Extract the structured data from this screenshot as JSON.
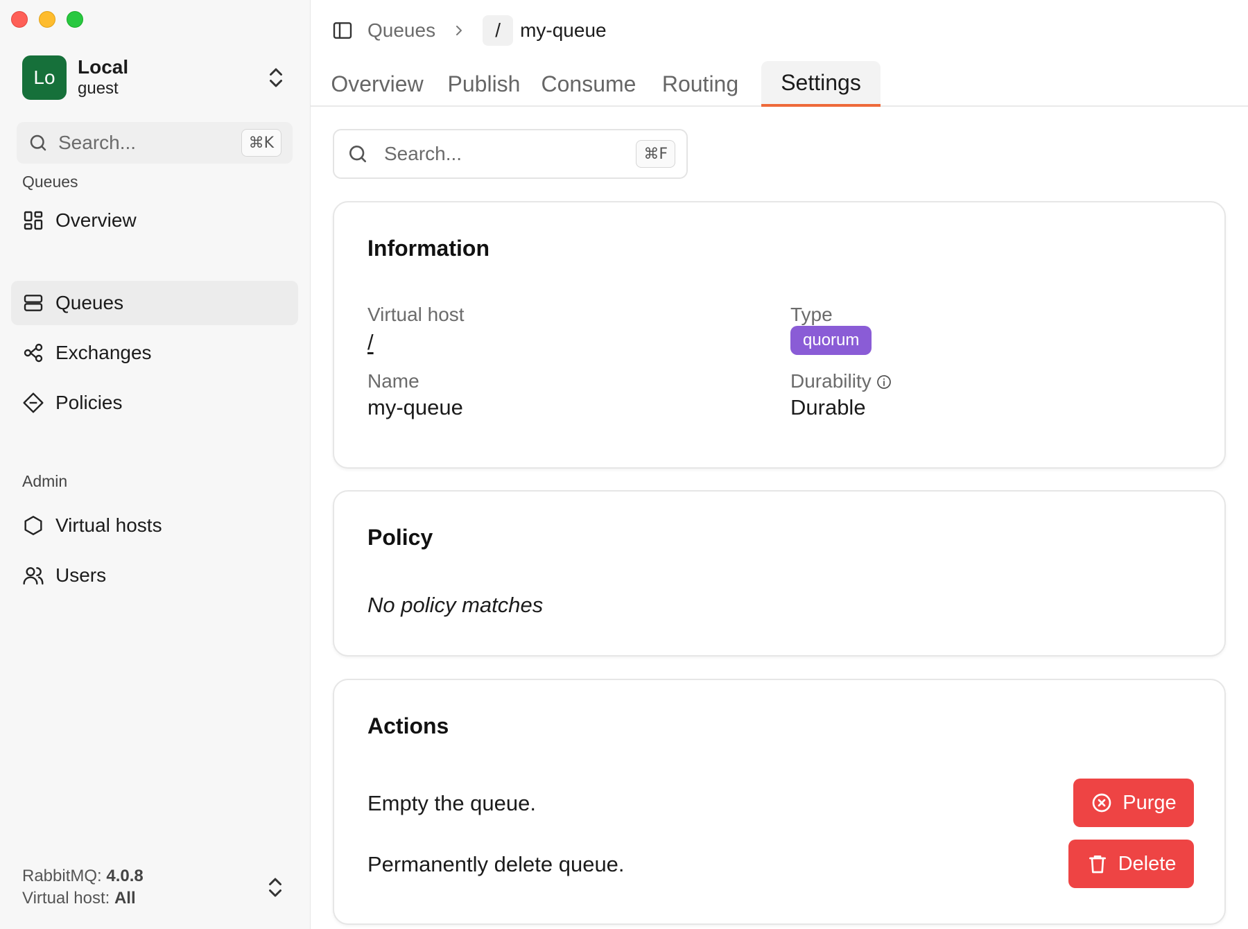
{
  "connection": {
    "initials": "Lo",
    "name": "Local",
    "user": "guest"
  },
  "sidebar": {
    "search_placeholder": "Search...",
    "search_shortcut": "⌘K",
    "queues_section": "Queues",
    "admin_section": "Admin",
    "items": [
      {
        "label": "Overview",
        "icon": "grid-icon"
      },
      {
        "label": "Queues",
        "icon": "queues-icon",
        "active": true
      },
      {
        "label": "Exchanges",
        "icon": "exchange-icon"
      },
      {
        "label": "Policies",
        "icon": "policy-icon"
      },
      {
        "label": "Virtual hosts",
        "icon": "hexagon-icon"
      },
      {
        "label": "Users",
        "icon": "users-icon"
      }
    ],
    "footer": {
      "version_label": "RabbitMQ:",
      "version": "4.0.8",
      "vhost_label": "Virtual host:",
      "vhost": "All"
    }
  },
  "breadcrumb": {
    "section": "Queues",
    "vhost": "/",
    "queue": "my-queue"
  },
  "tabs": [
    "Overview",
    "Publish",
    "Consume",
    "Routing",
    "Settings"
  ],
  "active_tab": "Settings",
  "search": {
    "placeholder": "Search...",
    "shortcut": "⌘F"
  },
  "information": {
    "title": "Information",
    "virtual_host_label": "Virtual host",
    "virtual_host": "/",
    "type_label": "Type",
    "type": "quorum",
    "name_label": "Name",
    "name": "my-queue",
    "durability_label": "Durability",
    "durability": "Durable"
  },
  "policy": {
    "title": "Policy",
    "text": "No policy matches"
  },
  "actions": {
    "title": "Actions",
    "purge_text": "Empty the queue.",
    "purge_label": "Purge",
    "delete_text": "Permanently delete queue.",
    "delete_label": "Delete"
  },
  "colors": {
    "accent": "#ee6a3a",
    "avatar": "#16703a",
    "badge": "#8a5cd6",
    "danger": "#ee4444"
  }
}
